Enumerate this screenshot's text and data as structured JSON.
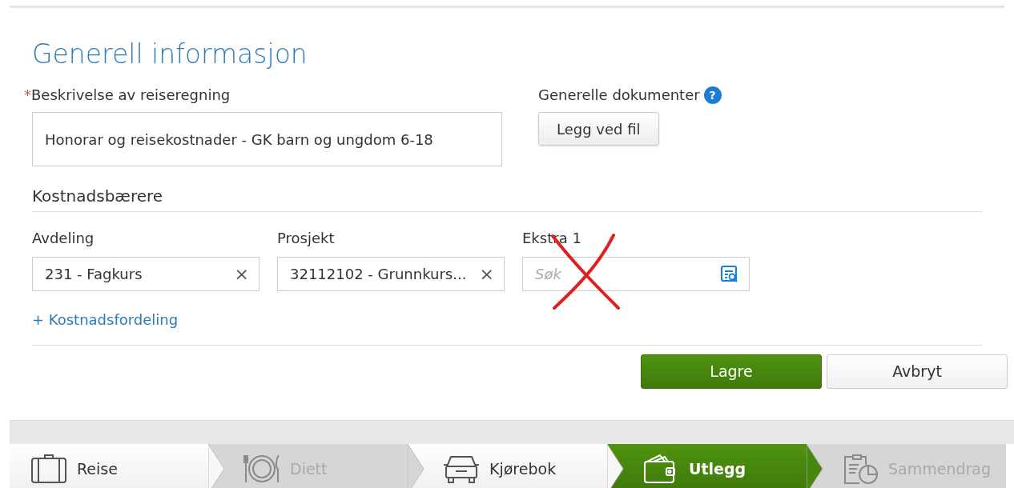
{
  "title": "Generell informasjon",
  "description": {
    "required_mark": "*",
    "label": "Beskrivelse av reiseregning",
    "value": "Honorar og reisekostnader - GK barn og ungdom 6-18"
  },
  "documents": {
    "label": "Generelle dokumenter",
    "help": "?",
    "button": "Legg ved fil"
  },
  "cost_carriers": {
    "heading": "Kostnadsbærere",
    "fields": [
      {
        "label": "Avdeling",
        "value": "231 - Fagkurs",
        "clear": "×"
      },
      {
        "label": "Prosjekt",
        "value": "32112102 - Grunnkurs...",
        "clear": "×"
      },
      {
        "label": "Ekstra 1",
        "placeholder": "Søk"
      }
    ],
    "add_link": "+ Kostnadsfordeling"
  },
  "buttons": [
    {
      "label": "Lagre",
      "kind": "primary"
    },
    {
      "label": "Avbryt",
      "kind": "secondary"
    }
  ],
  "steps": [
    {
      "label": "Reise",
      "kind": "suitcase",
      "selected": false,
      "disabled": false
    },
    {
      "label": "Diett",
      "kind": "plate",
      "selected": false,
      "disabled": true
    },
    {
      "label": "Kjørebok",
      "kind": "car",
      "selected": false,
      "disabled": false
    },
    {
      "label": "Utlegg",
      "kind": "wallet",
      "selected": true,
      "disabled": false
    },
    {
      "label": "Sammendrag",
      "kind": "clipboard",
      "selected": false,
      "disabled": true
    }
  ]
}
